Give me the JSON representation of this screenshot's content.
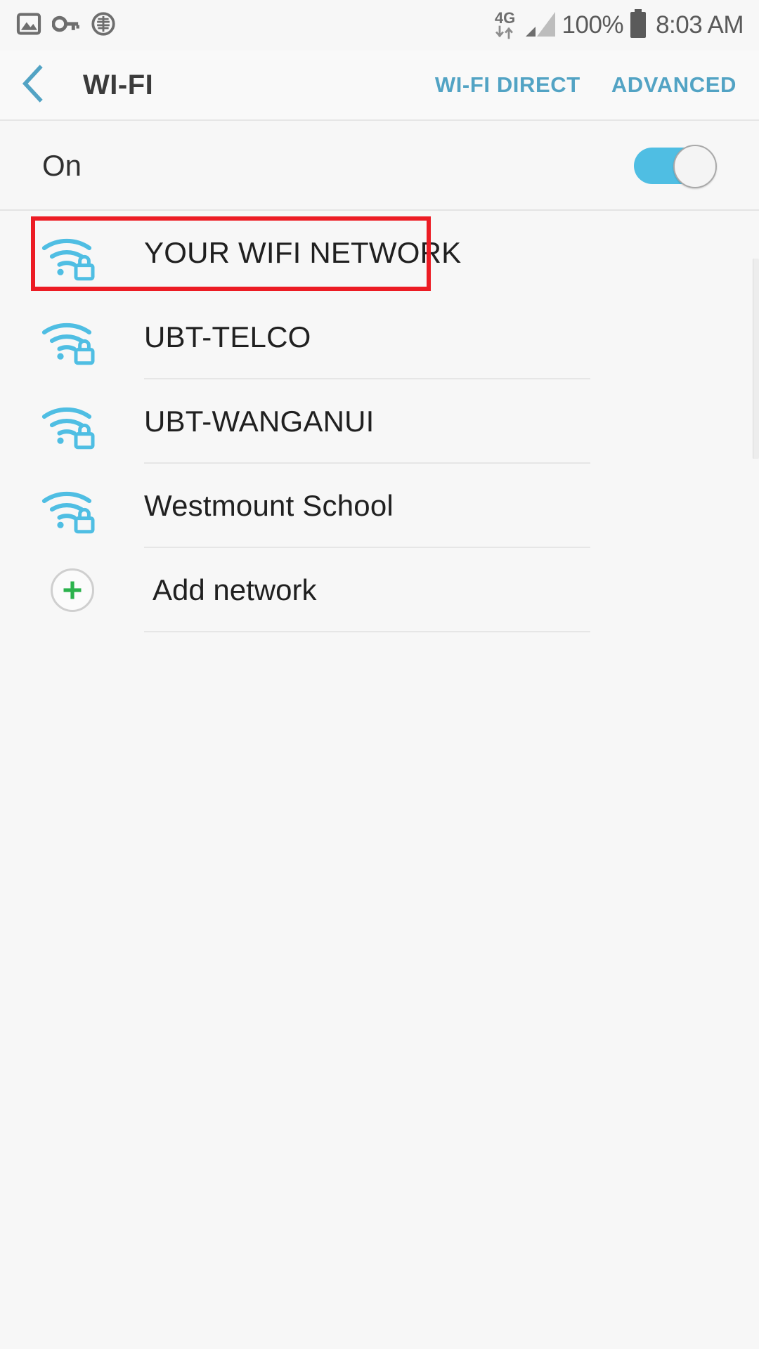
{
  "status_bar": {
    "icons_left": [
      {
        "name": "image-icon",
        "label": "Screenshot captured"
      },
      {
        "name": "key-icon",
        "label": "VPN active"
      },
      {
        "name": "data-saver-icon",
        "label": "Data saver"
      }
    ],
    "network_type": "4G",
    "signal_bars_total": 4,
    "signal_bars_filled": 1,
    "battery_percent": "100%",
    "battery_level": 100,
    "time": "8:03 AM"
  },
  "app_bar": {
    "back_label": "Back",
    "title": "WI-FI",
    "actions": [
      {
        "name": "wifi-direct",
        "label": "WI-FI DIRECT"
      },
      {
        "name": "advanced",
        "label": "ADVANCED"
      }
    ]
  },
  "wifi_toggle": {
    "label": "On",
    "state": "on"
  },
  "networks": [
    {
      "ssid": "YOUR WIFI NETWORK",
      "secured": true,
      "signal_bars": 3,
      "highlighted": true
    },
    {
      "ssid": "UBT-TELCO",
      "secured": true,
      "signal_bars": 3,
      "highlighted": false
    },
    {
      "ssid": "UBT-WANGANUI",
      "secured": true,
      "signal_bars": 3,
      "highlighted": false
    },
    {
      "ssid": "Westmount School",
      "secured": true,
      "signal_bars": 3,
      "highlighted": false
    }
  ],
  "add_network": {
    "label": "Add network",
    "icon": "plus-icon"
  },
  "colors": {
    "accent_blue": "#4fbee3",
    "action_blue": "#52a3c4",
    "highlight_red": "#ec1c24",
    "add_green": "#2bb24c",
    "background": "#f7f7f7",
    "text_primary": "#202020",
    "text_status": "#5a5a5a",
    "divider": "#e6e6e6"
  }
}
